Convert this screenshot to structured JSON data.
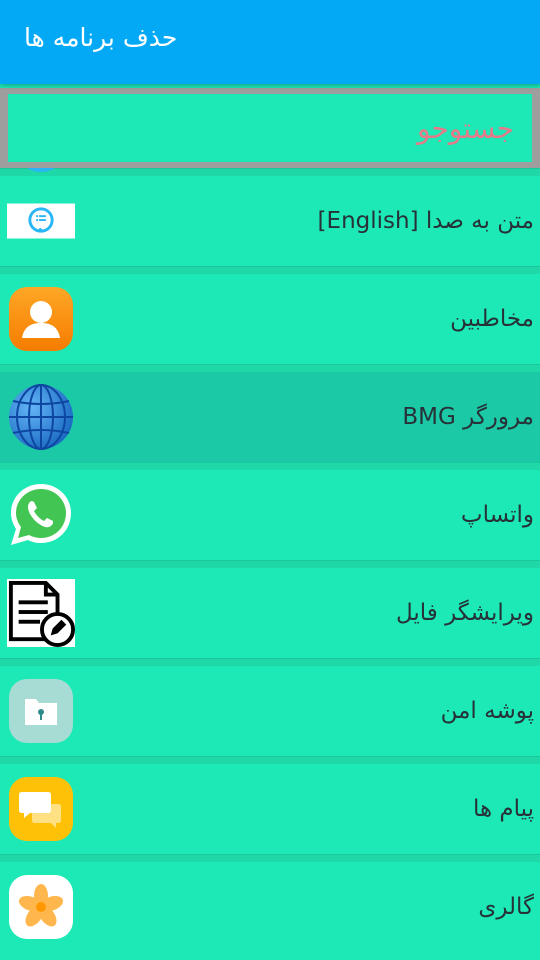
{
  "appbar": {
    "title": "حذف برنامه ها"
  },
  "search": {
    "placeholder": "جستوجو"
  },
  "apps": [
    {
      "label": "متن به صدا [English]",
      "icon": "tts-speech-icon"
    },
    {
      "label": "مخاطبین",
      "icon": "contacts-icon"
    },
    {
      "label": "مرورگر BMG",
      "icon": "globe-browser-icon",
      "selected": true
    },
    {
      "label": "واتساپ",
      "icon": "whatsapp-icon"
    },
    {
      "label": "ویرایشگر فایل",
      "icon": "file-editor-icon"
    },
    {
      "label": "پوشه امن",
      "icon": "secure-folder-icon"
    },
    {
      "label": "پیام ها",
      "icon": "messages-icon"
    },
    {
      "label": "گالری",
      "icon": "gallery-icon"
    }
  ],
  "colors": {
    "appbar": "#03a9f4",
    "list_background": "#1de9b6",
    "selected_row": "#1cc9a6",
    "search_text": "#e57a8a"
  }
}
